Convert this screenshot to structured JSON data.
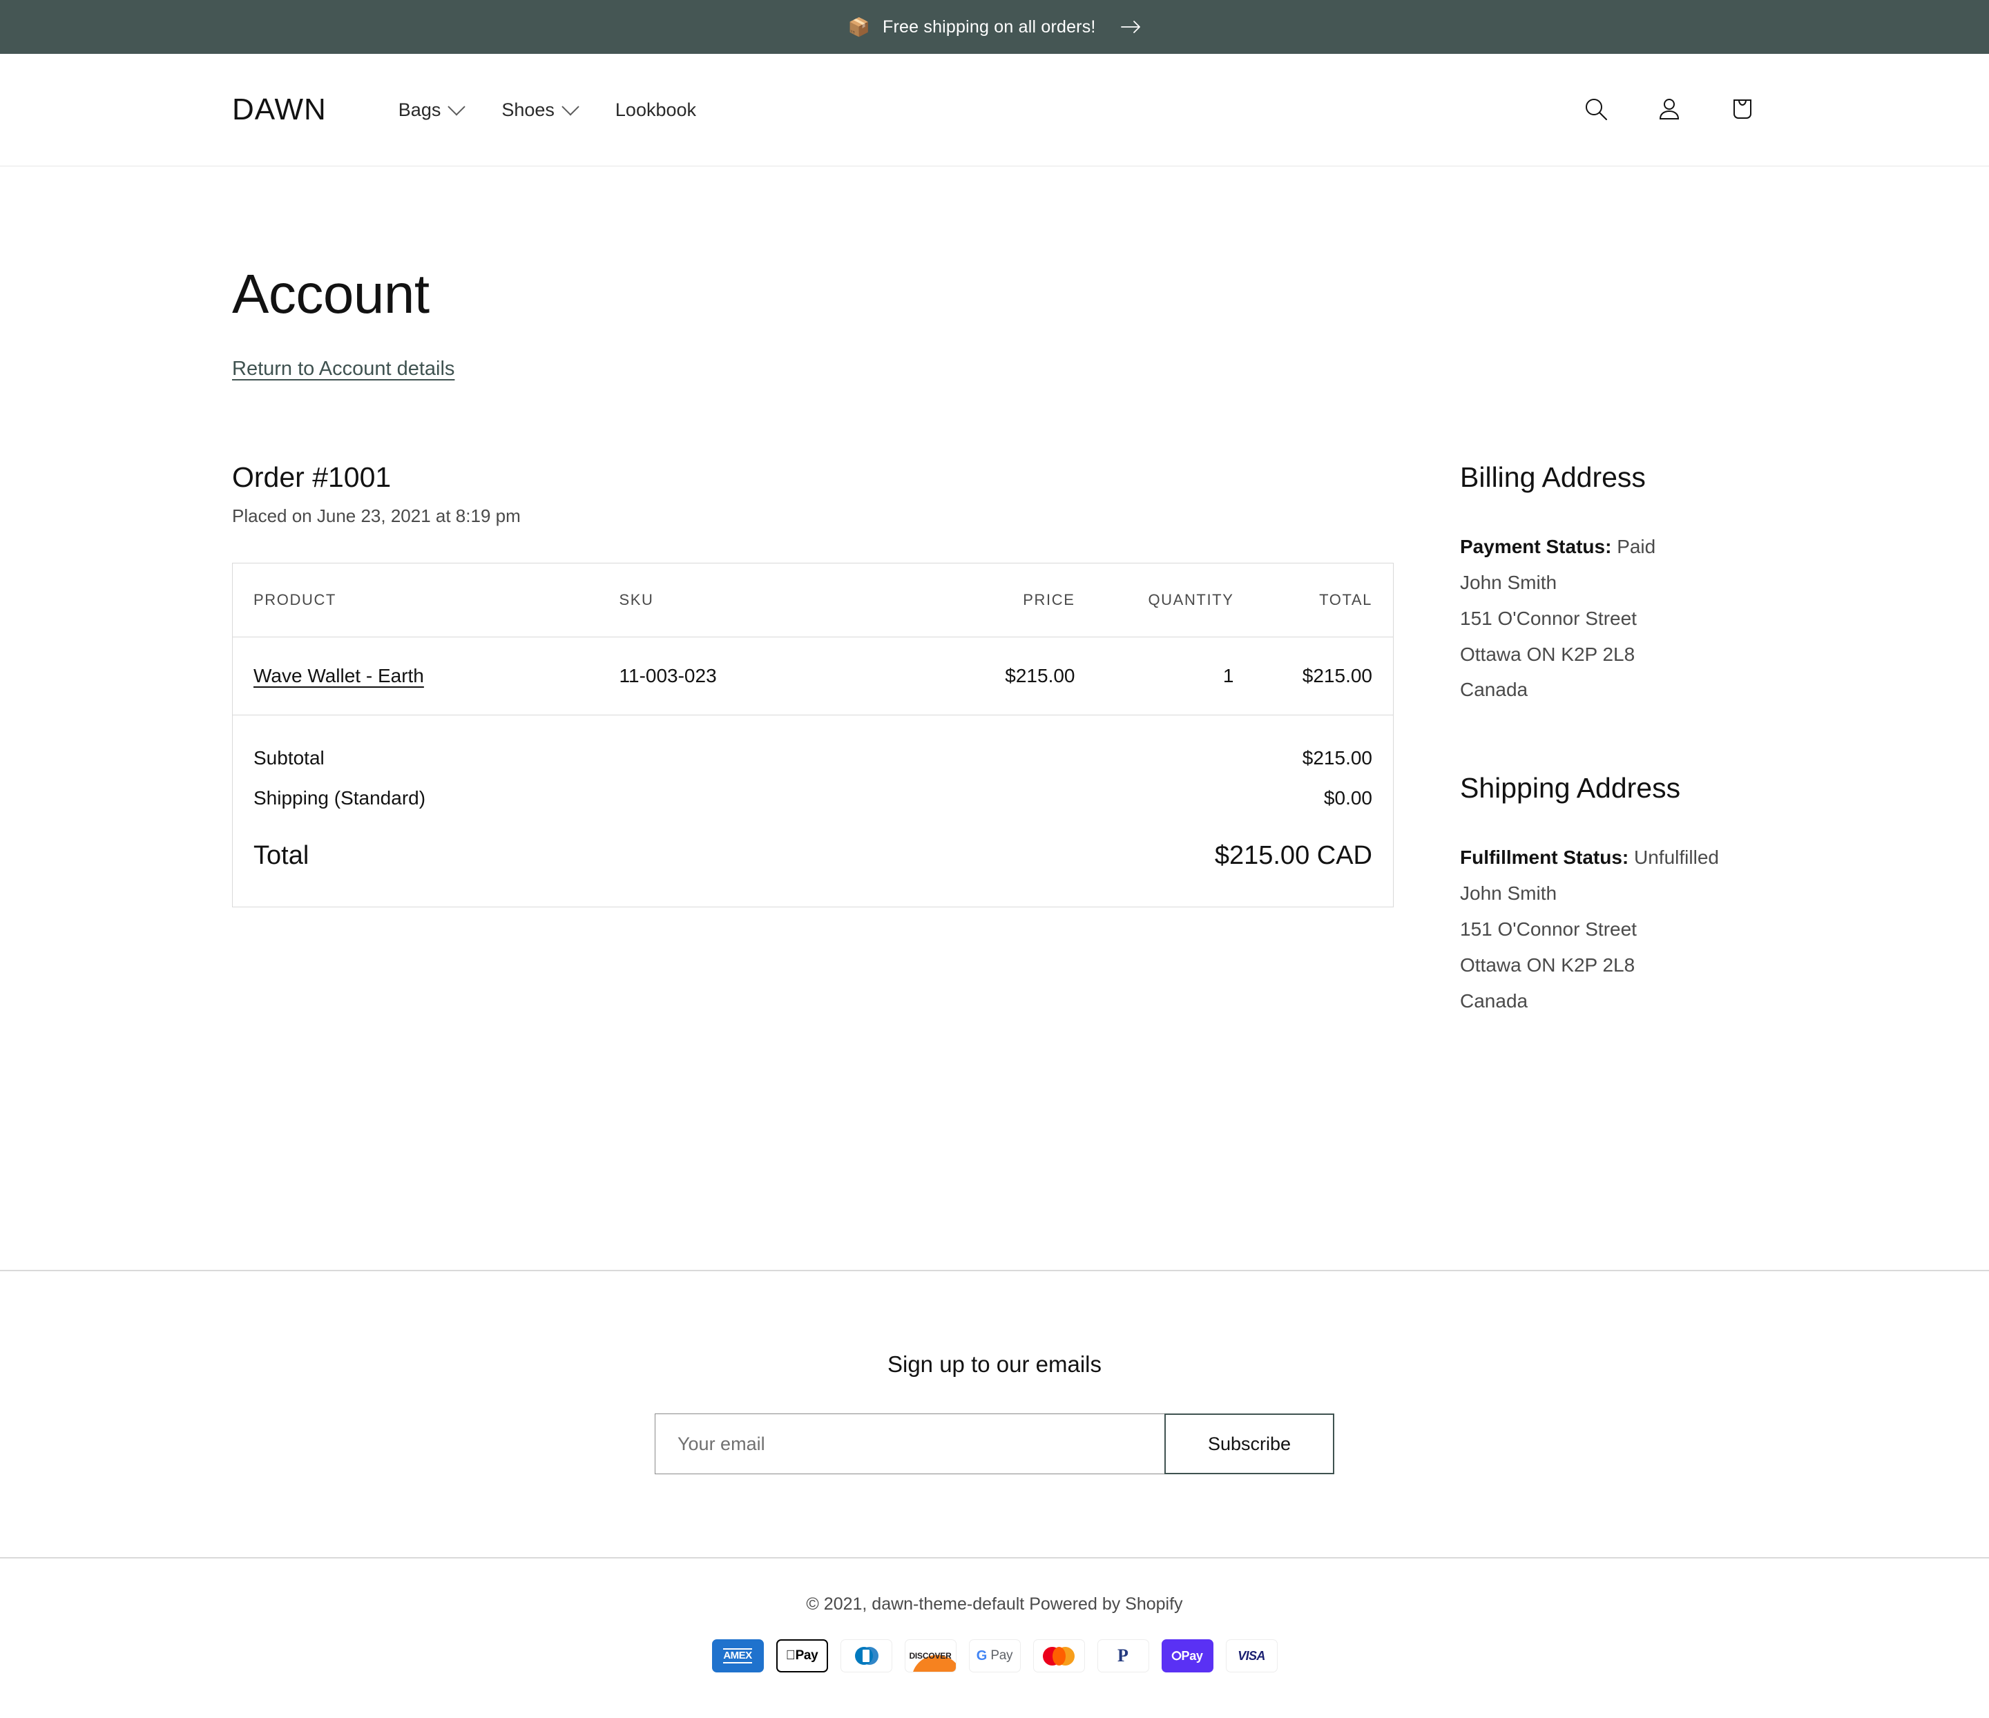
{
  "announcement": {
    "emoji": "📦",
    "text": "Free shipping on all orders!",
    "arrow_icon": "arrow-right-icon"
  },
  "header": {
    "logo": "DAWN",
    "nav": [
      {
        "label": "Bags",
        "has_dropdown": true
      },
      {
        "label": "Shoes",
        "has_dropdown": true
      },
      {
        "label": "Lookbook",
        "has_dropdown": false
      }
    ],
    "actions": [
      {
        "icon": "search-icon"
      },
      {
        "icon": "account-icon"
      },
      {
        "icon": "cart-icon"
      }
    ]
  },
  "page": {
    "title": "Account",
    "return_link": "Return to Account details"
  },
  "order": {
    "heading": "Order #1001",
    "placed_on": "Placed on June 23, 2021 at 8:19 pm",
    "table": {
      "headers": {
        "product": "PRODUCT",
        "sku": "SKU",
        "price": "PRICE",
        "quantity": "QUANTITY",
        "total": "TOTAL"
      },
      "rows": [
        {
          "product": "Wave Wallet - Earth",
          "sku": "11-003-023",
          "price": "$215.00",
          "quantity": "1",
          "total": "$215.00"
        }
      ],
      "summary": {
        "subtotal_label": "Subtotal",
        "subtotal_value": "$215.00",
        "shipping_label": "Shipping (Standard)",
        "shipping_value": "$0.00",
        "total_label": "Total",
        "total_value": "$215.00 CAD"
      }
    }
  },
  "billing": {
    "heading": "Billing Address",
    "status_label": "Payment Status:",
    "status_value": "Paid",
    "name": "John Smith",
    "street": "151 O'Connor Street",
    "city_region": "Ottawa ON K2P 2L8",
    "country": "Canada"
  },
  "shipping": {
    "heading": "Shipping Address",
    "status_label": "Fulfillment Status:",
    "status_value": "Unfulfilled",
    "name": "John Smith",
    "street": "151 O'Connor Street",
    "city_region": "Ottawa ON K2P 2L8",
    "country": "Canada"
  },
  "newsletter": {
    "heading": "Sign up to our emails",
    "email_placeholder": "Your email",
    "email_value": "",
    "subscribe_label": "Subscribe"
  },
  "footer": {
    "copyright": "© 2021, dawn-theme-default Powered by Shopify",
    "payment_methods": [
      {
        "name": "amex",
        "label": "AMEX"
      },
      {
        "name": "apple-pay",
        "label": "Pay"
      },
      {
        "name": "diners-club",
        "label": "Diners Club"
      },
      {
        "name": "discover",
        "label": "DISCOVER"
      },
      {
        "name": "google-pay",
        "label": "Pay"
      },
      {
        "name": "mastercard",
        "label": "Mastercard"
      },
      {
        "name": "paypal",
        "label": "PayPal"
      },
      {
        "name": "shop-pay",
        "label": "Pay"
      },
      {
        "name": "visa",
        "label": "VISA"
      }
    ]
  },
  "colors": {
    "announcement_bg": "#455654",
    "accent": "#3f5250",
    "text": "#121212",
    "muted": "#4a4a4a",
    "border": "#d9d9d9"
  }
}
